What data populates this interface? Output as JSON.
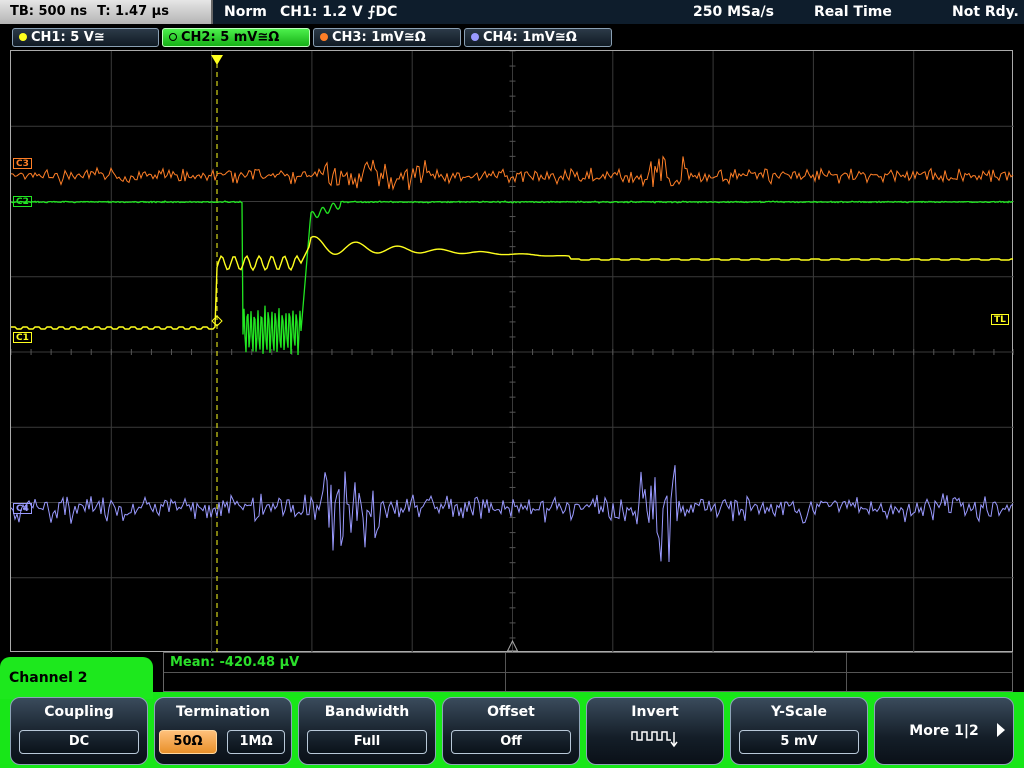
{
  "topbar": {
    "timebase": "TB: 500 ns",
    "trigger_time": "T: 1.47 µs",
    "mode": "Norm",
    "trigger_source": "CH1: 1.2 V",
    "trigger_slope_coupling": "⨍DC",
    "sample_rate": "250 MSa/s",
    "acq_mode": "Real Time",
    "status": "Not Rdy."
  },
  "channels": [
    {
      "label": "CH1: 5 V≅",
      "color": "#ffff1e",
      "active": false
    },
    {
      "label": "CH2: 5 mV≅Ω",
      "color": "#22e622",
      "active": true
    },
    {
      "label": "CH3: 1mV≅Ω",
      "color": "#ff7f27",
      "active": false
    },
    {
      "label": "CH4: 1mV≅Ω",
      "color": "#9a9aff",
      "active": false
    }
  ],
  "markers": {
    "ch3": "C3",
    "ch2": "C2",
    "ch1": "C1",
    "ch4": "C4",
    "trigger_level": "TL"
  },
  "measurement": {
    "text": "Mean: -420.48 µV"
  },
  "menu": {
    "title": "Channel 2",
    "coupling": {
      "label": "Coupling",
      "value": "DC"
    },
    "termination": {
      "label": "Termination",
      "options": [
        "50Ω",
        "1MΩ"
      ],
      "selected": "50Ω"
    },
    "bandwidth": {
      "label": "Bandwidth",
      "value": "Full"
    },
    "offset": {
      "label": "Offset",
      "value": "Off"
    },
    "invert": {
      "label": "Invert",
      "icon": "pulse-train-invert-icon"
    },
    "yscale": {
      "label": "Y-Scale",
      "value": "5 mV"
    },
    "more": {
      "label": "More 1|2"
    }
  },
  "colors": {
    "ch1": "#ffff1e",
    "ch2": "#22e622",
    "ch3": "#ff7f27",
    "ch4": "#9a9aff",
    "softkey_bar": "#18e618"
  }
}
